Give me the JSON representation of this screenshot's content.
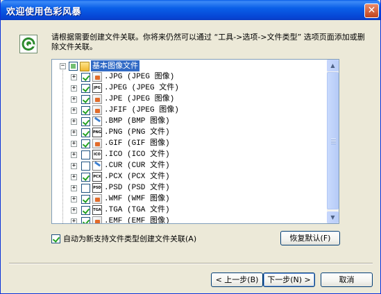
{
  "window": {
    "title": "欢迎使用色彩风暴",
    "close_glyph": "✕"
  },
  "header": {
    "icon": "app-logo-icon",
    "intro": "请根据需要创建文件关联。你将来仍然可以通过 “工具->选项->文件类型” 选项页面添加或删除文件关联。"
  },
  "tree": {
    "root": {
      "label": "基本图像文件",
      "expanded": true,
      "check_state": "partial"
    },
    "items": [
      {
        "label": ".JPG (JPEG 图像)",
        "checked": true,
        "icon": "image-file-icon"
      },
      {
        "label": ".JPEG (JPEG 文件)",
        "checked": true,
        "icon": "jpg-file-icon"
      },
      {
        "label": ".JPE (JPEG 图像)",
        "checked": true,
        "icon": "image-file-icon"
      },
      {
        "label": ".JFIF (JPEG 图像)",
        "checked": true,
        "icon": "image-file-icon"
      },
      {
        "label": ".BMP (BMP 图像)",
        "checked": true,
        "icon": "bmp-file-icon"
      },
      {
        "label": ".PNG (PNG 文件)",
        "checked": true,
        "icon": "png-file-icon"
      },
      {
        "label": ".GIF (GIF 图像)",
        "checked": true,
        "icon": "image-file-icon"
      },
      {
        "label": ".ICO (ICO 文件)",
        "checked": false,
        "icon": "ico-file-icon"
      },
      {
        "label": ".CUR (CUR 文件)",
        "checked": false,
        "icon": "bmp-file-icon"
      },
      {
        "label": ".PCX (PCX 文件)",
        "checked": true,
        "icon": "pcx-file-icon"
      },
      {
        "label": ".PSD (PSD 文件)",
        "checked": false,
        "icon": "psd-file-icon"
      },
      {
        "label": ".WMF (WMF 图像)",
        "checked": true,
        "icon": "image-file-icon"
      },
      {
        "label": ".TGA (TGA 文件)",
        "checked": true,
        "icon": "tga-file-icon"
      },
      {
        "label": ".EMF (EMF 图像)",
        "checked": true,
        "icon": "image-file-icon"
      }
    ],
    "icon_text": {
      "jpg": "JPG",
      "png": "PNG",
      "ico": "ICO",
      "cur": "BMP",
      "pcx": "PCX",
      "psd": "PSD",
      "tga": "TGA"
    }
  },
  "options": {
    "auto_associate_label": "自动为新支持文件类型创建文件关联(A)",
    "auto_associate_checked": true
  },
  "buttons": {
    "restore_default": "恢复默认(F)",
    "back": "< 上一步(B)",
    "next": "下一步(N) >",
    "cancel": "取消"
  },
  "colors": {
    "accent": "#316ac5",
    "title_bar": "#0a5fe8",
    "dialog_bg": "#ece9d8"
  }
}
